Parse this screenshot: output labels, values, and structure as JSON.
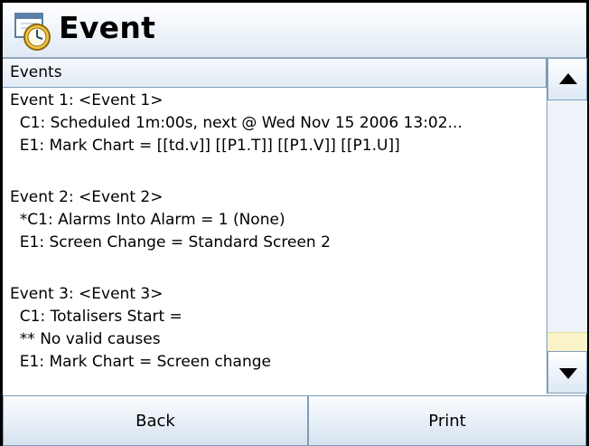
{
  "window": {
    "title": "Event",
    "icon": "clock-calendar-icon"
  },
  "list": {
    "header": "Events",
    "lines": [
      "Event 1: <Event 1>",
      "  C1: Scheduled 1m:00s, next @ Wed Nov 15 2006 13:02...",
      "  E1: Mark Chart = [[td.v]] [[P1.T]] [[P1.V]] [[P1.U]]",
      "",
      "Event 2: <Event 2>",
      "  *C1: Alarms Into Alarm = 1 (None)",
      "  E1: Screen Change = Standard Screen 2",
      "",
      "Event 3: <Event 3>",
      "  C1: Totalisers Start =",
      "  ** No valid causes",
      "  E1: Mark Chart = Screen change"
    ]
  },
  "scrollbar": {
    "up_icon": "arrow-up-icon",
    "down_icon": "arrow-down-icon"
  },
  "buttons": {
    "back": "Back",
    "print": "Print"
  },
  "colors": {
    "border": "#7f9db9",
    "button_top": "#fafcfe",
    "button_bottom": "#d6e2ef",
    "thumb": "#fbf3c9"
  }
}
